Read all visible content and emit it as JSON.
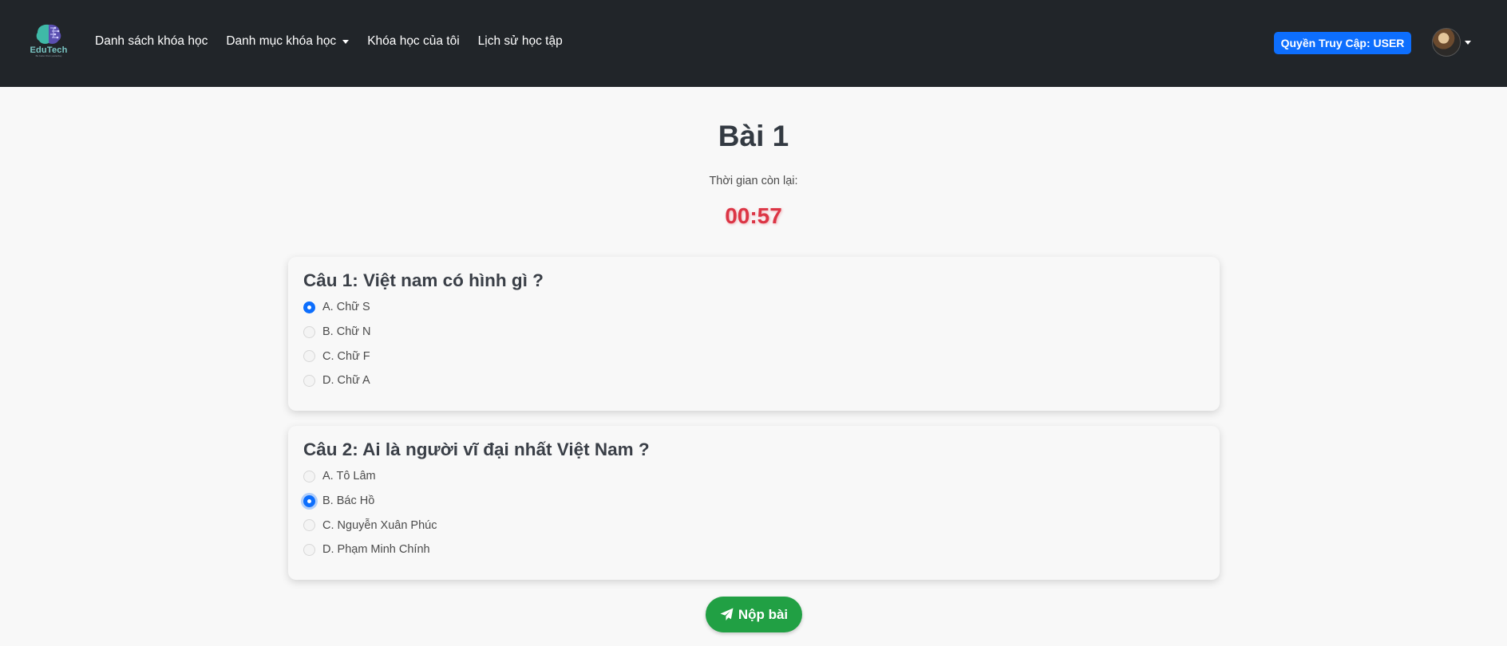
{
  "brand": {
    "name": "EduTech",
    "tagline": "Be better than yesterday"
  },
  "nav": {
    "links": [
      {
        "label": "Danh sách khóa học"
      },
      {
        "label": "Danh mục khóa học",
        "dropdown": true
      },
      {
        "label": "Khóa học của tôi"
      },
      {
        "label": "Lịch sử học tập"
      }
    ],
    "role_badge": "Quyền Truy Cập: USER"
  },
  "quiz": {
    "title": "Bài 1",
    "timer_label": "Thời gian còn lại:",
    "timer_value": "00:57",
    "questions": [
      {
        "text": "Câu 1: Việt nam có hình gì ?",
        "options": [
          "A. Chữ S",
          "B. Chữ N",
          "C. Chữ F",
          "D. Chữ A"
        ],
        "selected_index": 0
      },
      {
        "text": "Câu 2: Ai là người vĩ đại nhất Việt Nam ?",
        "options": [
          "A. Tô Lâm",
          "B. Bác Hồ",
          "C. Nguyễn Xuân Phúc",
          "D. Phạm Minh Chính"
        ],
        "selected_index": 1
      }
    ],
    "submit_label": "Nộp bài"
  },
  "colors": {
    "navbar": "#212529",
    "accent": "#0d6efd",
    "timer": "#dc3545",
    "submit": "#21a044"
  },
  "icons": {
    "logo": "brain-icon",
    "submit": "paper-plane-icon",
    "dropdown": "caret-down-icon"
  }
}
